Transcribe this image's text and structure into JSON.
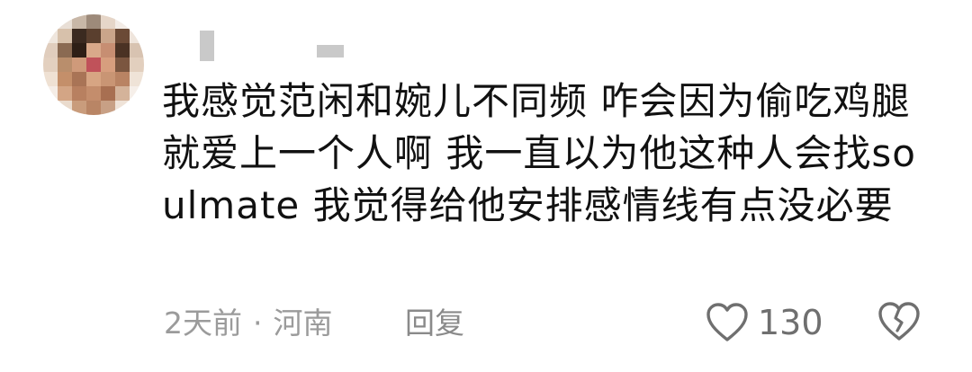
{
  "comment": {
    "username": "",
    "text": "我感觉范闲和婉儿不同频 咋会因为偷吃鸡腿就爱上一个人啊 我一直以为他这种人会找soulmate 我觉得给他安排感情线有点没必要",
    "time": "2天前",
    "separator": "·",
    "location": "河南",
    "reply_label": "回复",
    "like_count": "130"
  },
  "icons": {
    "like": "heart-outline-icon",
    "dislike": "broken-heart-icon"
  },
  "colors": {
    "text": "#111111",
    "meta": "#9b9b9b",
    "icon": "#6f6f6f"
  }
}
